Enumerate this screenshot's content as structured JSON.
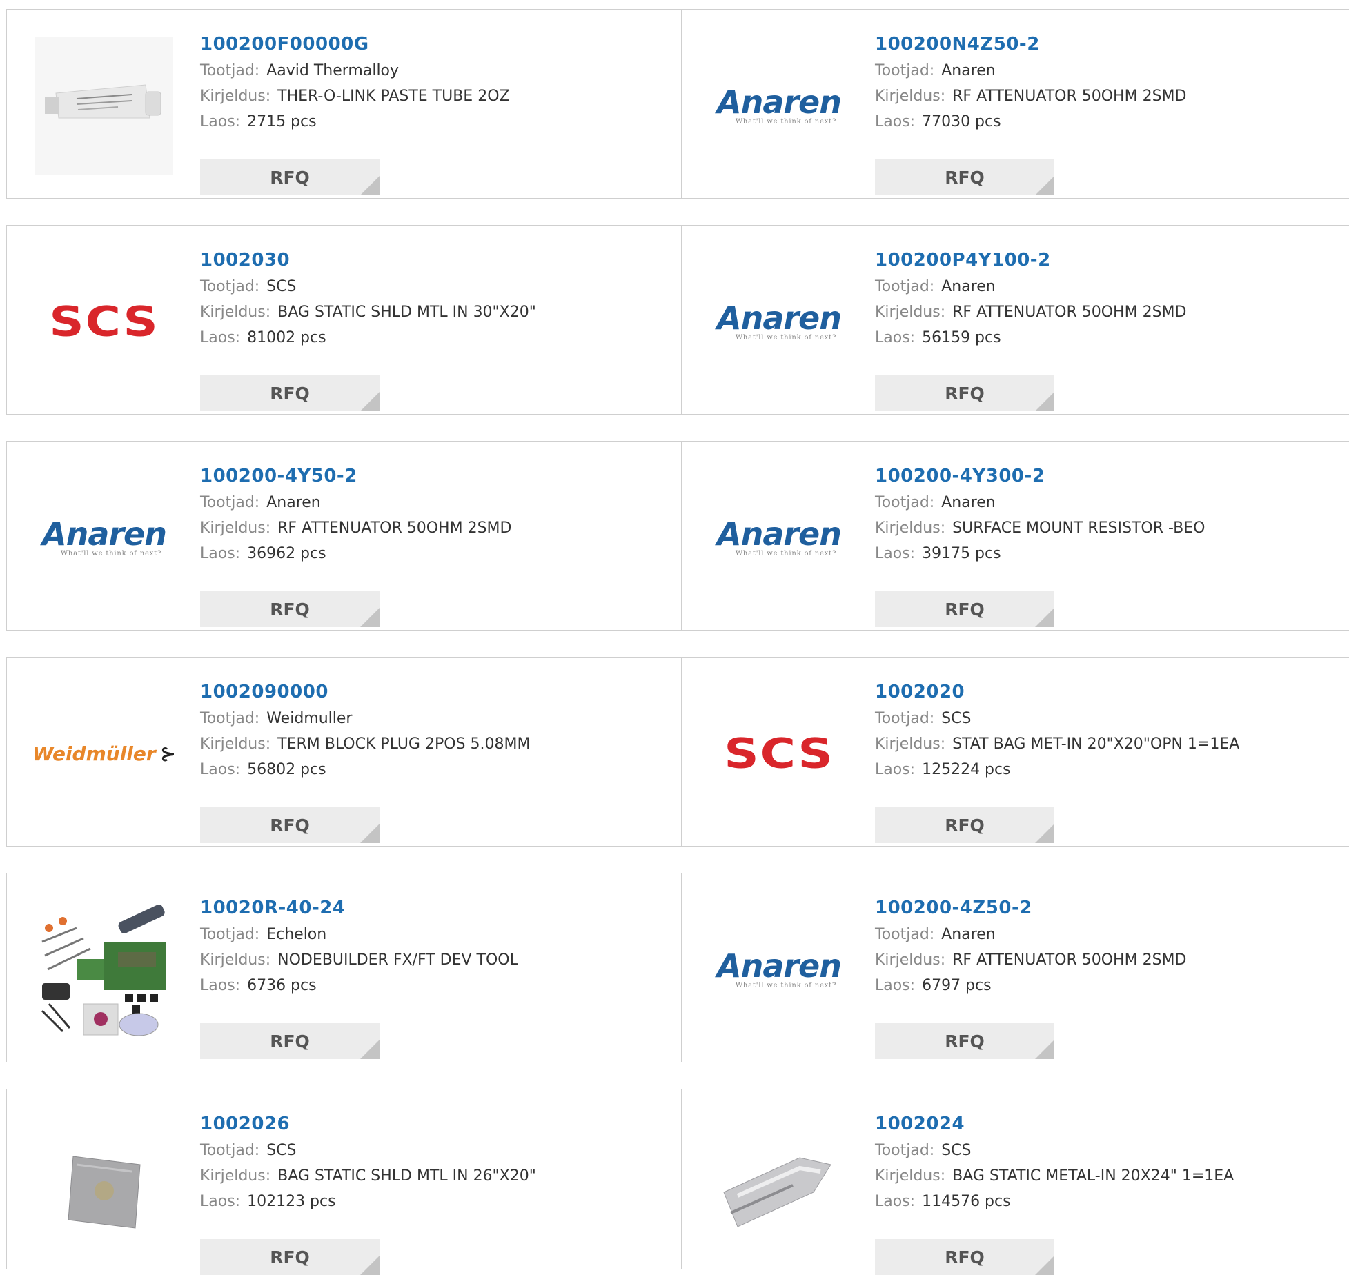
{
  "labels": {
    "manufacturer": "Tootjad:",
    "description": "Kirjeldus:",
    "stock": "Laos:",
    "rfq": "RFQ"
  },
  "products": [
    {
      "part": "100200F00000G",
      "manufacturer": "Aavid Thermalloy",
      "description": "THER-O-LINK PASTE TUBE 2OZ",
      "stock": "2715 pcs",
      "image": "paste-tube-image"
    },
    {
      "part": "100200N4Z50-2",
      "manufacturer": "Anaren",
      "description": "RF ATTENUATOR 50OHM 2SMD",
      "stock": "77030 pcs",
      "image": "anaren-logo"
    },
    {
      "part": "1002030",
      "manufacturer": "SCS",
      "description": "BAG STATIC SHLD MTL IN 30\"X20\"",
      "stock": "81002 pcs",
      "image": "scs-logo"
    },
    {
      "part": "100200P4Y100-2",
      "manufacturer": "Anaren",
      "description": "RF ATTENUATOR 50OHM 2SMD",
      "stock": "56159 pcs",
      "image": "anaren-logo"
    },
    {
      "part": "100200-4Y50-2",
      "manufacturer": "Anaren",
      "description": "RF ATTENUATOR 50OHM 2SMD",
      "stock": "36962 pcs",
      "image": "anaren-logo"
    },
    {
      "part": "100200-4Y300-2",
      "manufacturer": "Anaren",
      "description": "SURFACE MOUNT RESISTOR -BEO",
      "stock": "39175 pcs",
      "image": "anaren-logo"
    },
    {
      "part": "1002090000",
      "manufacturer": "Weidmuller",
      "description": "TERM BLOCK PLUG 2POS 5.08MM",
      "stock": "56802 pcs",
      "image": "weidmuller-logo"
    },
    {
      "part": "1002020",
      "manufacturer": "SCS",
      "description": "STAT BAG MET-IN 20\"X20\"OPN 1=1EA",
      "stock": "125224 pcs",
      "image": "scs-logo"
    },
    {
      "part": "10020R-40-24",
      "manufacturer": "Echelon",
      "description": "NODEBUILDER FX/FT DEV TOOL",
      "stock": "6736 pcs",
      "image": "dev-kit-image"
    },
    {
      "part": "100200-4Z50-2",
      "manufacturer": "Anaren",
      "description": "RF ATTENUATOR 50OHM 2SMD",
      "stock": "6797 pcs",
      "image": "anaren-logo"
    },
    {
      "part": "1002026",
      "manufacturer": "SCS",
      "description": "BAG STATIC SHLD MTL IN 26\"X20\"",
      "stock": "102123 pcs",
      "image": "static-bag-image"
    },
    {
      "part": "1002024",
      "manufacturer": "SCS",
      "description": "BAG STATIC METAL-IN 20X24\" 1=1EA",
      "stock": "114576 pcs",
      "image": "metal-bag-image"
    }
  ],
  "logos": {
    "anaren_word": "Anaren",
    "anaren_tagline": "What'll we think of next?",
    "scs_word": "SCS",
    "weidmuller_word": "Weidmüller"
  },
  "colors": {
    "part_link": "#1e6db0",
    "anaren_blue": "#1f5f9e",
    "scs_red": "#d9262b",
    "weidmuller_orange": "#e8872a",
    "rfq_bg": "#ececec"
  }
}
